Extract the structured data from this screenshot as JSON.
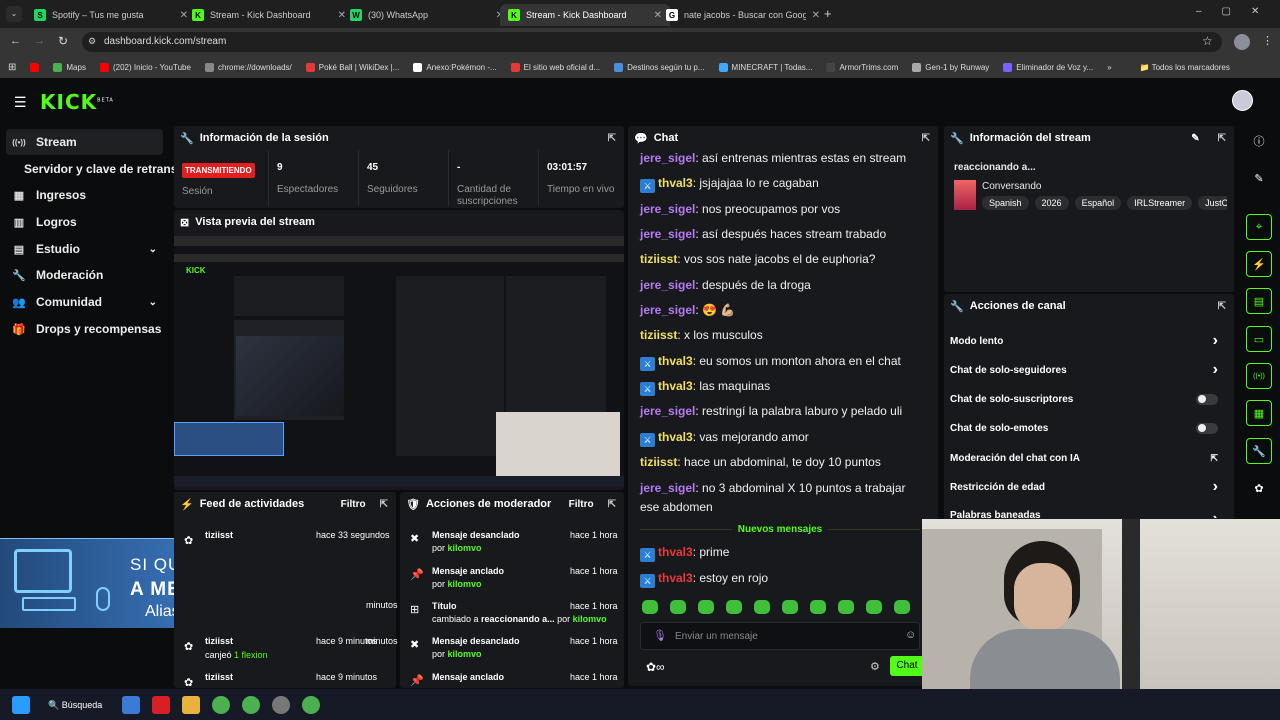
{
  "browser": {
    "tabs": [
      {
        "title": "Spotify – Tus me gusta",
        "color": "#1ed760",
        "glyph": "S"
      },
      {
        "title": "Stream - Kick Dashboard",
        "color": "#53fc18",
        "glyph": "K"
      },
      {
        "title": "(30) WhatsApp",
        "color": "#25d366",
        "glyph": "W"
      },
      {
        "title": "Stream - Kick Dashboard",
        "color": "#53fc18",
        "glyph": "K"
      },
      {
        "title": "nate jacobs - Buscar con Google",
        "color": "#ffffff",
        "glyph": "G"
      }
    ],
    "new_tab": "+",
    "url": "dashboard.kick.com/stream",
    "bookmarks": [
      "Maps",
      "(202) Inicio - YouTube",
      "chrome://downloads/",
      "Poké Ball | WikiDex |...",
      "Anexo:Pokémon -...",
      "El sitio web oficial d...",
      "Destinos según tu p...",
      "MINECRAFT | Todas...",
      "ArmorTrims.com",
      "Gen-1 by Runway",
      "Eliminador de Voz y..."
    ],
    "bookmarks_more": "»",
    "all_bookmarks": "Todos los marcadores"
  },
  "kick": {
    "logo": "KICK",
    "logo_sup": "BETA",
    "accent": "#53fc18"
  },
  "sidebar": {
    "items": [
      {
        "label": "Stream",
        "icon": "broadcast-icon",
        "glyph": "((•))"
      },
      {
        "label": "Servidor y clave de retransm",
        "icon": "",
        "glyph": ""
      },
      {
        "label": "Ingresos",
        "icon": "revenue-icon",
        "glyph": "▦"
      },
      {
        "label": "Logros",
        "icon": "achievements-icon",
        "glyph": "▥"
      },
      {
        "label": "Estudio",
        "icon": "studio-icon",
        "glyph": "▤"
      },
      {
        "label": "Moderación",
        "icon": "wrench-icon",
        "glyph": "🔧"
      },
      {
        "label": "Comunidad",
        "icon": "community-icon",
        "glyph": "👥"
      },
      {
        "label": "Drops y recompensas",
        "icon": "gift-icon",
        "glyph": "🎁"
      }
    ]
  },
  "session": {
    "title": "Información de la sesión",
    "live_badge": "TRANSMITIENDO",
    "session_label": "Sesión",
    "viewers": "9",
    "viewers_label": "Espectadores",
    "followers": "45",
    "followers_label": "Seguidores",
    "subs": "-",
    "subs_label": "Cantidad de suscripciones",
    "uptime": "03:01:57",
    "uptime_label": "Tiempo en vivo"
  },
  "preview": {
    "title": "Vista previa del stream",
    "overlay_line1": "SI QUERES AYUDARME",
    "overlay_line2": "A MEJORAR MI PC",
    "overlay_alias": "Alias: ULISES.KLV"
  },
  "feed": {
    "title": "Feed de actividades",
    "filter": "Filtro",
    "rows": [
      {
        "user": "tiziisst",
        "time": "hace 33 segundos",
        "sub": ""
      },
      {
        "user": "",
        "time": "minutos",
        "sub": ""
      },
      {
        "user": "",
        "time": "minutos",
        "sub": ""
      },
      {
        "user": "tiziisst",
        "time": "hace 9 minutos",
        "sub": "canjeó",
        "sub2": "1 flexion"
      },
      {
        "user": "tiziisst",
        "time": "hace 9 minutos",
        "sub": ""
      }
    ]
  },
  "modactions": {
    "title": "Acciones de moderador",
    "filter": "Filtro",
    "rows": [
      {
        "action": "Mensaje desanclado",
        "by": "por",
        "mod": "kilomvo",
        "time": "hace 1 hora",
        "icon": "unpin-icon",
        "glyph": "✖"
      },
      {
        "action": "Mensaje anclado",
        "by": "por",
        "mod": "kilomvo",
        "time": "hace 1 hora",
        "icon": "pin-icon",
        "glyph": "📌"
      },
      {
        "action": "Título",
        "by": "cambiado a",
        "extra": "reaccionando a...",
        "by2": "por",
        "mod": "kilomvo",
        "time": "hace 1 hora",
        "icon": "title-icon",
        "glyph": "⊞"
      },
      {
        "action": "Mensaje desanclado",
        "by": "por",
        "mod": "kilomvo",
        "time": "hace 1 hora",
        "icon": "unpin-icon",
        "glyph": "✖"
      },
      {
        "action": "Mensaje anclado",
        "by": "",
        "mod": "",
        "time": "hace 1 hora",
        "icon": "pin-icon",
        "glyph": "📌"
      }
    ]
  },
  "chat": {
    "title": "Chat",
    "messages": [
      {
        "user": "jere_sigel",
        "color": "#b57cf2",
        "mod": false,
        "text": "así entrenas mientras estas en stream"
      },
      {
        "user": "thval3",
        "color": "#f0e060",
        "mod": true,
        "text": "jsjajajaa lo re cagaban"
      },
      {
        "user": "jere_sigel",
        "color": "#b57cf2",
        "mod": false,
        "text": "nos preocupamos por vos"
      },
      {
        "user": "jere_sigel",
        "color": "#b57cf2",
        "mod": false,
        "text": "así después haces stream trabado"
      },
      {
        "user": "tiziisst",
        "color": "#f0e060",
        "mod": false,
        "text": "vos sos nate jacobs el de euphoria?"
      },
      {
        "user": "jere_sigel",
        "color": "#b57cf2",
        "mod": false,
        "text": "después de la droga"
      },
      {
        "user": "jere_sigel",
        "color": "#b57cf2",
        "mod": false,
        "text": "😍 💪🏼"
      },
      {
        "user": "tiziisst",
        "color": "#f0e060",
        "mod": false,
        "text": "x los musculos"
      },
      {
        "user": "thval3",
        "color": "#f0e060",
        "mod": true,
        "text": "eu somos un monton ahora en el chat"
      },
      {
        "user": "thval3",
        "color": "#f0e060",
        "mod": true,
        "text": "las maquinas"
      },
      {
        "user": "jere_sigel",
        "color": "#b57cf2",
        "mod": false,
        "text": "restringí la palabra laburo y pelado uli"
      },
      {
        "user": "thval3",
        "color": "#f0e060",
        "mod": true,
        "text": "vas mejorando amor"
      },
      {
        "user": "tiziisst",
        "color": "#f0e060",
        "mod": false,
        "text": "hace un abdominal, te doy 10 puntos"
      },
      {
        "user": "jere_sigel",
        "color": "#b57cf2",
        "mod": false,
        "text": "no 3 abdominal X 10 puntos a trabajar ese abdomen"
      }
    ],
    "new_messages": "Nuevos mensajes",
    "new": [
      {
        "user": "thval3",
        "color": "#e83a3a",
        "mod": true,
        "text": "prime"
      },
      {
        "user": "thval3",
        "color": "#e83a3a",
        "mod": true,
        "text": "estoy en rojo"
      }
    ],
    "placeholder": "Enviar un mensaje",
    "send": "Chat"
  },
  "streaminfo": {
    "title": "Información del stream",
    "stream_title": "reaccionando a...",
    "category": "Conversando",
    "tags": [
      "Spanish",
      "2026",
      "Español",
      "IRLStreamer",
      "JustC"
    ]
  },
  "channel": {
    "title": "Acciones de canal",
    "items": [
      {
        "label": "Modo lento",
        "control": "chevron"
      },
      {
        "label": "Chat de solo-seguidores",
        "control": "chevron"
      },
      {
        "label": "Chat de solo-suscriptores",
        "control": "toggle"
      },
      {
        "label": "Chat de solo-emotes",
        "control": "toggle"
      },
      {
        "label": "Moderación del chat con IA",
        "control": "external"
      },
      {
        "label": "Restricción de edad",
        "control": "chevron"
      },
      {
        "label": "Palabras baneadas",
        "control": "chevron"
      }
    ]
  },
  "taskbar": {
    "search": "Búsqueda"
  }
}
